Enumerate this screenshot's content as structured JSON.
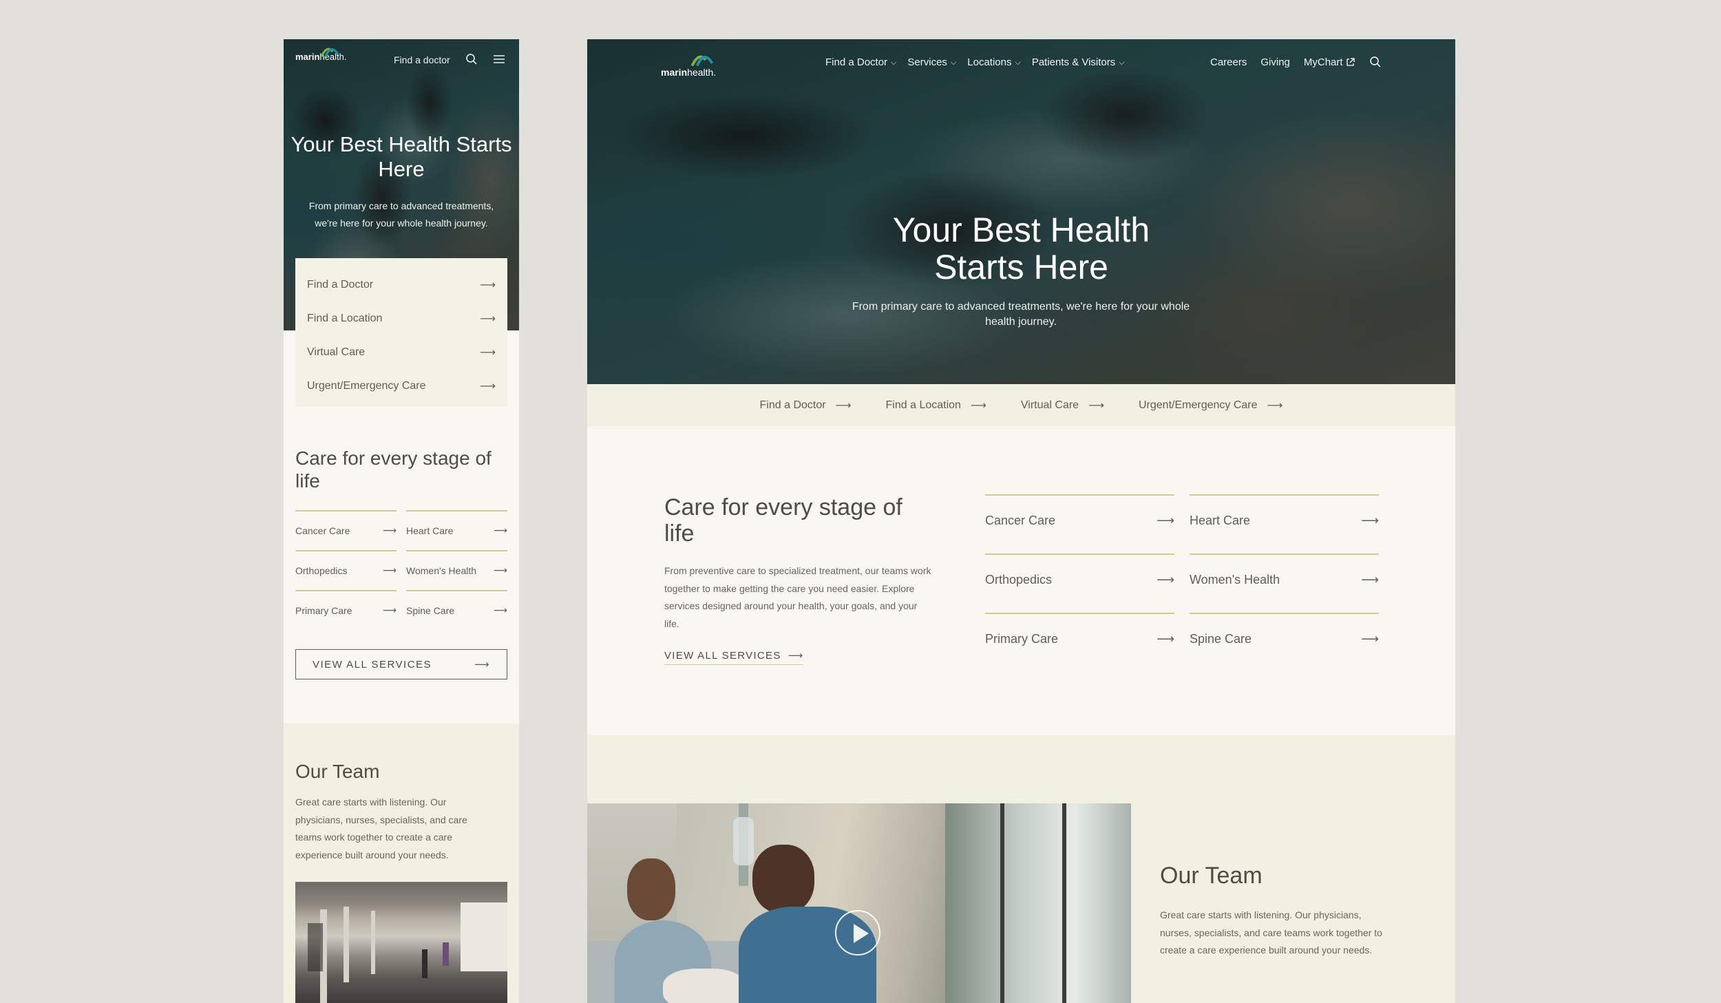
{
  "brand": {
    "logo_text": "marinhealth",
    "logo_text_bold": "marin",
    "logo_text_light": "health."
  },
  "colors": {
    "accent_line": "#c9d08e",
    "panel": "#f1f1e2",
    "page_bg": "#e1e0da",
    "text": "#4d4d45"
  },
  "mobile": {
    "nav": {
      "find_doctor": "Find a doctor",
      "icons": [
        "search-icon",
        "hamburger-menu-icon"
      ]
    },
    "hero": {
      "title": "Your Best Health Starts Here",
      "subtitle": "From primary care to advanced treatments, we're here for your whole health journey."
    },
    "quick_links": [
      {
        "label": "Find a Doctor"
      },
      {
        "label": "Find a Location"
      },
      {
        "label": "Virtual Care"
      },
      {
        "label": "Urgent/Emergency Care"
      }
    ],
    "care": {
      "title": "Care for every stage of life",
      "services": [
        {
          "label": "Cancer Care"
        },
        {
          "label": "Heart Care"
        },
        {
          "label": "Orthopedics"
        },
        {
          "label": "Women's Health"
        },
        {
          "label": "Primary Care"
        },
        {
          "label": "Spine Care"
        }
      ],
      "view_all": "VIEW ALL SERVICES"
    },
    "team": {
      "title": "Our Team",
      "text": "Great care starts with listening. Our physicians, nurses, specialists, and care teams work together to create a care experience built around your needs."
    }
  },
  "desktop": {
    "nav": {
      "menu": [
        {
          "label": "Find a Doctor"
        },
        {
          "label": "Services"
        },
        {
          "label": "Locations"
        },
        {
          "label": "Patients & Visitors"
        }
      ],
      "utility": [
        {
          "label": "Careers"
        },
        {
          "label": "Giving"
        },
        {
          "label": "MyChart"
        }
      ]
    },
    "hero": {
      "title_line1": "Your Best Health",
      "title_line2": "Starts Here",
      "subtitle": "From primary care to advanced treatments, we're here for your whole health journey."
    },
    "quick_links": [
      {
        "label": "Find a Doctor"
      },
      {
        "label": "Find a Location"
      },
      {
        "label": "Virtual Care"
      },
      {
        "label": "Urgent/Emergency Care"
      }
    ],
    "care": {
      "title": "Care for every stage of life",
      "text": "From preventive care to specialized treatment, our teams work together to make getting the care you need easier. Explore services designed around your health, your goals, and your life.",
      "view_all": "VIEW ALL SERVICES",
      "services": [
        {
          "label": "Cancer Care"
        },
        {
          "label": "Heart Care"
        },
        {
          "label": "Orthopedics"
        },
        {
          "label": "Women's Health"
        },
        {
          "label": "Primary Care"
        },
        {
          "label": "Spine Care"
        }
      ]
    },
    "team": {
      "title": "Our Team",
      "text": "Great care starts with listening. Our physicians, nurses, specialists, and care teams work together to create a care experience built around your needs."
    }
  }
}
